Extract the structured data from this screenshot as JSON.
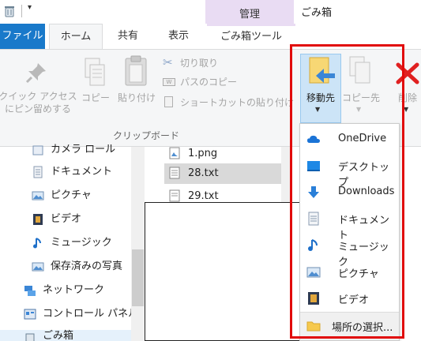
{
  "titlebar": {
    "context_tab": "管理",
    "window_title": "ごみ箱"
  },
  "tabs": {
    "file": "ファイル",
    "home": "ホーム",
    "share": "共有",
    "view": "表示",
    "recycle_tools": "ごみ箱ツール"
  },
  "ribbon": {
    "pin_quick_access": "クイック アクセス\nにピン留めする",
    "copy": "コピー",
    "paste": "貼り付け",
    "cut": "切り取り",
    "copy_path": "パスのコピー",
    "paste_shortcut": "ショートカットの貼り付け",
    "group_clipboard": "クリップボード",
    "move_to": "移動先",
    "copy_to": "コピー先",
    "delete": "削除"
  },
  "nav": {
    "items": [
      {
        "label": "カメラ ロール",
        "icon": "camera-roll-icon"
      },
      {
        "label": "ドキュメント",
        "icon": "documents-icon"
      },
      {
        "label": "ピクチャ",
        "icon": "pictures-icon"
      },
      {
        "label": "ビデオ",
        "icon": "videos-icon"
      },
      {
        "label": "ミュージック",
        "icon": "music-icon"
      },
      {
        "label": "保存済みの写真",
        "icon": "saved-pictures-icon"
      },
      {
        "label": "ネットワーク",
        "icon": "network-icon"
      },
      {
        "label": "コントロール パネル",
        "icon": "control-panel-icon"
      },
      {
        "label": "ごみ箱",
        "icon": "recycle-bin-icon"
      }
    ]
  },
  "files": {
    "items": [
      "1.png",
      "28.txt",
      "29.txt"
    ]
  },
  "menu": {
    "items": [
      {
        "label": "OneDrive",
        "icon": "onedrive-icon"
      },
      {
        "label": "デスクトップ",
        "icon": "desktop-icon"
      },
      {
        "label": "Downloads",
        "icon": "downloads-icon"
      },
      {
        "label": "ドキュメント",
        "icon": "documents-icon"
      },
      {
        "label": "ミュージック",
        "icon": "music-icon"
      },
      {
        "label": "ピクチャ",
        "icon": "pictures-icon"
      },
      {
        "label": "ビデオ",
        "icon": "videos-icon"
      }
    ],
    "choose_location": "場所の選択..."
  },
  "colors": {
    "file_tab": "#1979ca",
    "context_tab": "#e9dcf3",
    "highlight": "#e10b0b"
  }
}
